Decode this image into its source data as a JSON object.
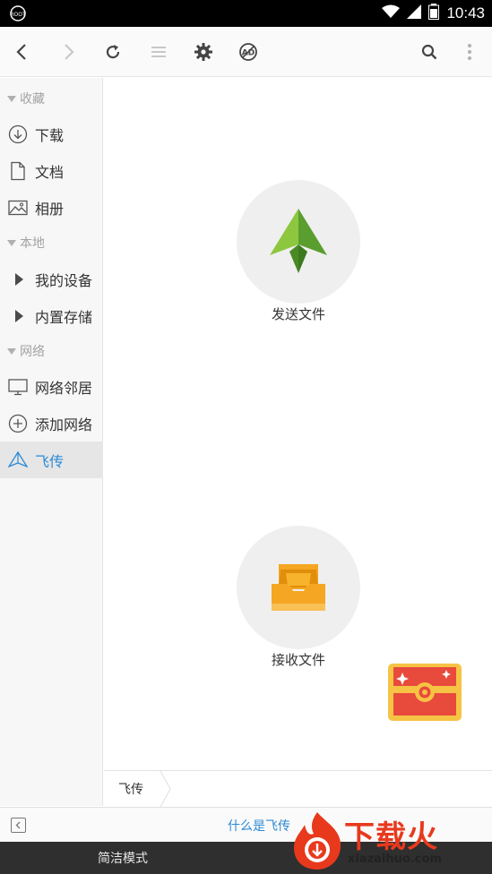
{
  "status_bar": {
    "time": "10:43"
  },
  "toolbar": {
    "buttons": [
      "back-icon",
      "forward-icon",
      "refresh-icon",
      "list-icon",
      "gear-icon",
      "ad-icon",
      "search-icon",
      "more-icon"
    ]
  },
  "sidebar": {
    "favorites": {
      "header": "收藏",
      "items": [
        {
          "label": "下载",
          "icon": "download-icon"
        },
        {
          "label": "文档",
          "icon": "document-icon"
        },
        {
          "label": "相册",
          "icon": "photo-icon"
        }
      ]
    },
    "local": {
      "header": "本地",
      "items": [
        {
          "label": "我的设备"
        },
        {
          "label": "内置存储"
        }
      ]
    },
    "network": {
      "header": "网络",
      "items": [
        {
          "label": "网络邻居",
          "icon": "monitor-icon"
        },
        {
          "label": "添加网络",
          "icon": "add-circle-icon"
        },
        {
          "label": "飞传",
          "icon": "paper-plane-icon",
          "active": true
        }
      ]
    }
  },
  "main": {
    "send_label": "发送文件",
    "receive_label": "接收文件"
  },
  "breadcrumb": {
    "current": "飞传"
  },
  "hint": {
    "link": "什么是飞传"
  },
  "mode_bar": {
    "simple_mode": "简洁模式"
  },
  "watermark": {
    "title": "下载火",
    "subtitle": "xiazaihuo.com"
  },
  "colors": {
    "accent": "#2b8ad6",
    "send_green": "#6cb43f",
    "receive_orange": "#f5a623",
    "watermark_red": "#e8391d"
  }
}
